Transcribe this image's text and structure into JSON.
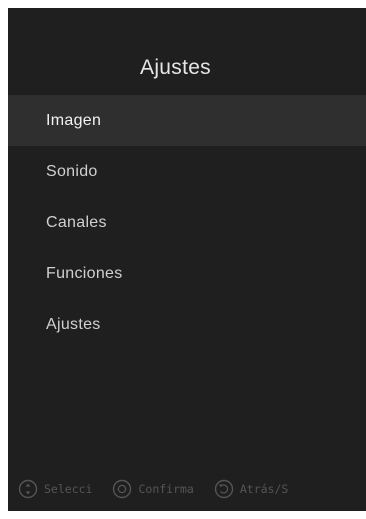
{
  "header": {
    "title": "Ajustes"
  },
  "menu": {
    "items": [
      {
        "label": "Imagen",
        "selected": true
      },
      {
        "label": "Sonido",
        "selected": false
      },
      {
        "label": "Canales",
        "selected": false
      },
      {
        "label": "Funciones",
        "selected": false
      },
      {
        "label": "Ajustes",
        "selected": false
      }
    ]
  },
  "hints": {
    "select": {
      "label": "Selecci",
      "icon": "dpad-up-down-icon"
    },
    "confirm": {
      "label": "Confirma",
      "icon": "ok-button-icon"
    },
    "back": {
      "label": "Atrás/S",
      "icon": "back-arrow-icon"
    }
  },
  "colors": {
    "background": "#1f1f1f",
    "selected_row": "#2f2f2f",
    "text": "#d0d0d0",
    "hint_text": "#555555"
  }
}
